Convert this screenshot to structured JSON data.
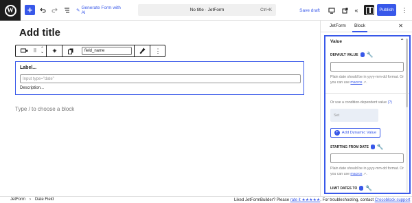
{
  "topbar": {
    "add_icon": "plus",
    "undo_icon": "undo-arrow",
    "redo_icon": "redo-arrow",
    "list_view_icon": "list-view",
    "ai_icon": "magic-wand",
    "generate_ai": "Generate Form with AI",
    "doc_title": "No title · JetForm",
    "shortcut": "Ctrl+K",
    "save_draft": "Save draft",
    "publish": "Publish",
    "accent": "#3858e9"
  },
  "editor": {
    "title_placeholder": "Add title",
    "toolbar": {
      "field_name": "field_name"
    },
    "block": {
      "label": "Label...",
      "input_placeholder": "Input type=\"date\"",
      "description": "Description..."
    },
    "type_hint": "Type / to choose a block"
  },
  "sidebar": {
    "tabs": [
      "JetForm",
      "Block"
    ],
    "active_tab": "Block",
    "panel_title": "Value",
    "default_value_label": "DEFAULT VALUE",
    "help_prefix": "Plain date should be in yyyy-mm-dd format. Or you can use ",
    "help_link": "macros",
    "help_suffix": " ↗.",
    "condition_label": "Or use a condition-dependent value",
    "condition_help": "(?)",
    "set_label": "Set",
    "add_dynamic": "Add Dynamic Value",
    "starting_from_label": "STARTING FROM DATE",
    "limit_dates_label": "LIMIT DATES TO"
  },
  "footer": {
    "breadcrumb": [
      "JetForm",
      "Date Field"
    ],
    "note_prefix": "Liked JetFormBuilder? Please ",
    "rate_link": "rate it ★★★★★",
    "note_mid": ". For troubleshooting, contact ",
    "support_link": "Crocoblock support"
  }
}
